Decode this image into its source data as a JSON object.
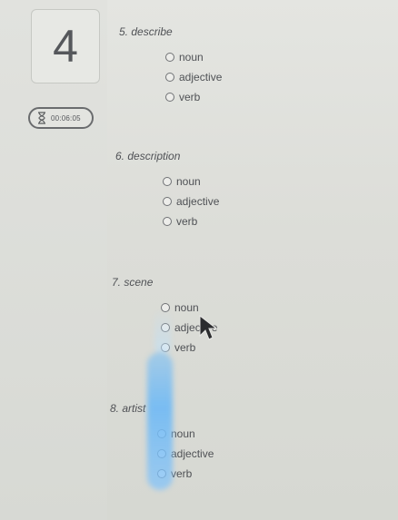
{
  "sidebar": {
    "question_number": "4",
    "timer": "00:06:05"
  },
  "questions": [
    {
      "title": "5. describe",
      "options": [
        "noun",
        "adjective",
        "verb"
      ]
    },
    {
      "title": "6. description",
      "options": [
        "noun",
        "adjective",
        "verb"
      ]
    },
    {
      "title": "7. scene",
      "options": [
        "noun",
        "adjective",
        "verb"
      ]
    },
    {
      "title": "8. artist",
      "options": [
        "noun",
        "adjective",
        "verb"
      ]
    }
  ],
  "icons": {
    "timer": "hourglass-icon",
    "pointer": "mouse-cursor-icon"
  },
  "colors": {
    "background": "#dcddd8",
    "text": "#4f5155",
    "glare": "#7bbdf5"
  }
}
